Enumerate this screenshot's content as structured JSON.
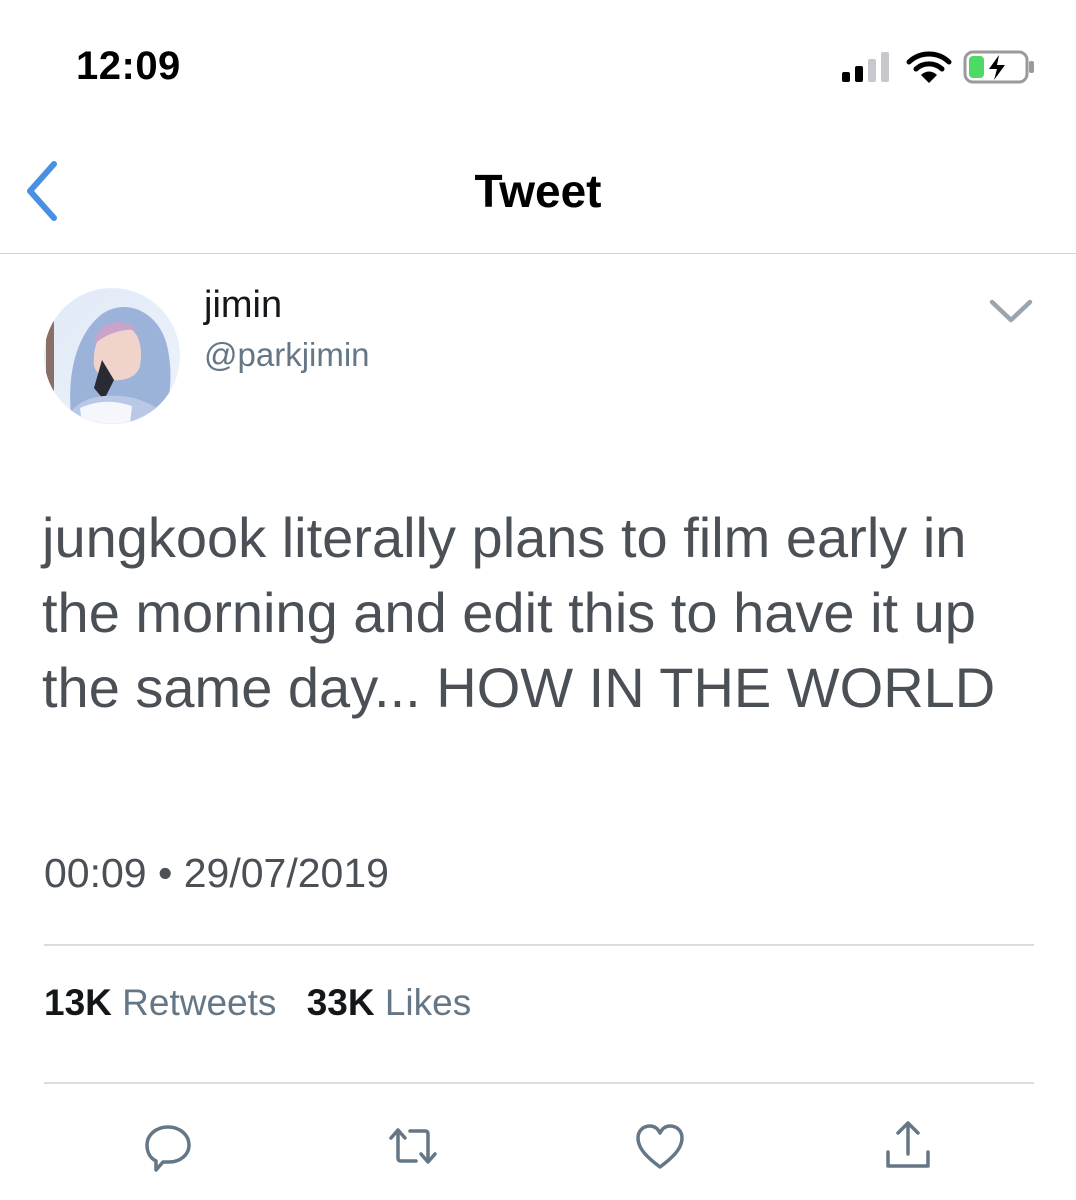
{
  "status_bar": {
    "time": "12:09",
    "icons": [
      "signal-bars-icon",
      "wifi-icon",
      "battery-charging-icon"
    ],
    "battery_color": "#4cd964"
  },
  "header": {
    "title": "Tweet",
    "back_icon": "chevron-left-icon"
  },
  "tweet": {
    "author": {
      "display_name": "jimin",
      "handle": "@parkjimin"
    },
    "menu_icon": "chevron-down-icon",
    "text": "jungkook literally plans to film early in the morning and edit this to have it up the same day... HOW IN THE WORLD",
    "timestamp": "00:09 • 29/07/2019",
    "stats": {
      "retweets_count": "13K",
      "retweets_label": "Retweets",
      "likes_count": "33K",
      "likes_label": "Likes"
    },
    "actions": [
      "reply-icon",
      "retweet-icon",
      "like-icon",
      "share-icon"
    ]
  },
  "colors": {
    "accent": "#4a90e2",
    "text_primary": "#14171a",
    "text_secondary": "#657786",
    "divider": "#d7dde2"
  }
}
